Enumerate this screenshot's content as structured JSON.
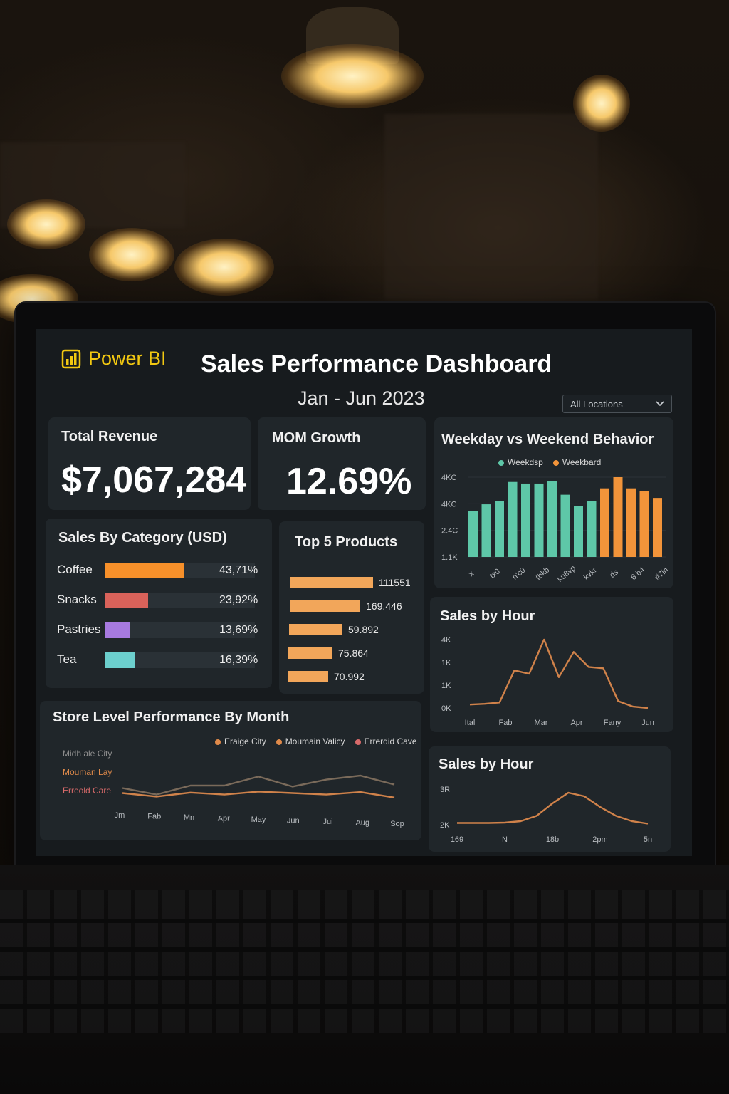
{
  "header": {
    "brand": "Power BI",
    "title": "Sales Performance Dashboard",
    "date_range": "Jan - Jun 2023",
    "location_filter": "All Locations"
  },
  "kpis": {
    "total_revenue": {
      "label": "Total Revenue",
      "value": "$7,067,284"
    },
    "mom_growth": {
      "label": "MOM Growth",
      "value": "12.69%"
    }
  },
  "colors": {
    "brand_yellow": "#f2c811",
    "weekday": "#5ec7a8",
    "weekend": "#f2943a",
    "coffee": "#f7902a",
    "snacks": "#d9625a",
    "pastries": "#a77ae0",
    "tea": "#6ccfcd",
    "products": "#f2a65a",
    "line_orange": "#d0824a",
    "line_muted": "#7a6a5a"
  },
  "sales_by_category": {
    "title": "Sales By Category (USD)",
    "items": [
      {
        "label": "Coffee",
        "pct": "43,71%",
        "share": 0.4371,
        "color": "#f7902a"
      },
      {
        "label": "Snacks",
        "pct": "23,92%",
        "share": 0.2392,
        "color": "#d9625a"
      },
      {
        "label": "Pastries",
        "pct": "13,69%",
        "share": 0.1369,
        "color": "#a77ae0"
      },
      {
        "label": "Tea",
        "pct": "16,39%",
        "share": 0.1639,
        "color": "#6ccfcd"
      }
    ]
  },
  "top_products": {
    "title": "Top 5 Products",
    "items": [
      {
        "value_label": "111551",
        "value": 111551
      },
      {
        "value_label": "169.446",
        "value": 95000
      },
      {
        "value_label": "59.892",
        "value": 72000
      },
      {
        "value_label": "75.864",
        "value": 60000
      },
      {
        "value_label": "70.992",
        "value": 55000
      }
    ]
  },
  "chart_data": [
    {
      "type": "bar",
      "title": "Weekday vs Weekend Behavior",
      "legend": [
        "Weekdsp",
        "Weekbard"
      ],
      "y_tick_labels": [
        "4KC",
        "4KC",
        "2.4C",
        "1.1K"
      ],
      "x_tick_labels": [
        "x",
        "tx0",
        "n'c0",
        "tbkb",
        "ku8vp",
        "kvkr",
        "ds",
        "6 b4",
        "#7in"
      ],
      "series": [
        {
          "name": "Weekdsp",
          "values": [
            58,
            66,
            70,
            94,
            92,
            92,
            95,
            78,
            64,
            70
          ],
          "color": "#5ec7a8"
        },
        {
          "name": "Weekbard",
          "values": [
            86,
            100,
            86,
            83,
            74
          ],
          "color": "#f2943a"
        }
      ],
      "ylim": [
        0,
        100
      ]
    },
    {
      "type": "line",
      "title": "Sales by Hour",
      "x_tick_labels": [
        "Ital",
        "Fab",
        "Mar",
        "Apr",
        "Fany",
        "Jun"
      ],
      "y_tick_labels": [
        "4K",
        "1K",
        "1K",
        "0K"
      ],
      "x": [
        0,
        1,
        2,
        3,
        4,
        5,
        6,
        7,
        8,
        9,
        10,
        11,
        12
      ],
      "values": [
        0.05,
        0.06,
        0.08,
        0.55,
        0.5,
        1.0,
        0.45,
        0.82,
        0.6,
        0.58,
        0.1,
        0.02,
        0.0
      ],
      "ylim": [
        0,
        1
      ],
      "color": "#d0824a"
    },
    {
      "type": "line",
      "title": "Sales by Hour",
      "x_tick_labels": [
        "169",
        "N",
        "18b",
        "2pm",
        "5n"
      ],
      "y_tick_labels": [
        "3R",
        "2K"
      ],
      "x": [
        0,
        1,
        2,
        3,
        4,
        5,
        6,
        7,
        8,
        9,
        10,
        11,
        12
      ],
      "values": [
        0.05,
        0.05,
        0.05,
        0.06,
        0.1,
        0.25,
        0.6,
        0.9,
        0.8,
        0.5,
        0.25,
        0.1,
        0.03
      ],
      "ylim": [
        0,
        1
      ],
      "color": "#d0824a"
    },
    {
      "type": "line",
      "title": "Store Level Performance By Month",
      "legend": [
        "Eraige City",
        "Moumain Valicy",
        "Errerdid Cave"
      ],
      "row_labels": [
        "Midh ale City",
        "Mouman Lay",
        "Erreold Care"
      ],
      "x_tick_labels": [
        "Jm",
        "Fab",
        "Mn",
        "Apr",
        "May",
        "Jun",
        "Jui",
        "Aug",
        "Sop"
      ],
      "series": [
        {
          "name": "Eraige City",
          "values": [
            55,
            48,
            56,
            52,
            58,
            55,
            52,
            57,
            46
          ],
          "color": "#d0824a"
        },
        {
          "name": "Moumain Valicy",
          "values": [
            65,
            52,
            70,
            70,
            88,
            68,
            82,
            90,
            72
          ],
          "color": "#7a6a5a"
        }
      ],
      "ylim": [
        0,
        100
      ]
    }
  ],
  "store_chart_legend_colors": [
    "#e08a4a",
    "#e08a4a",
    "#d86a6a"
  ]
}
